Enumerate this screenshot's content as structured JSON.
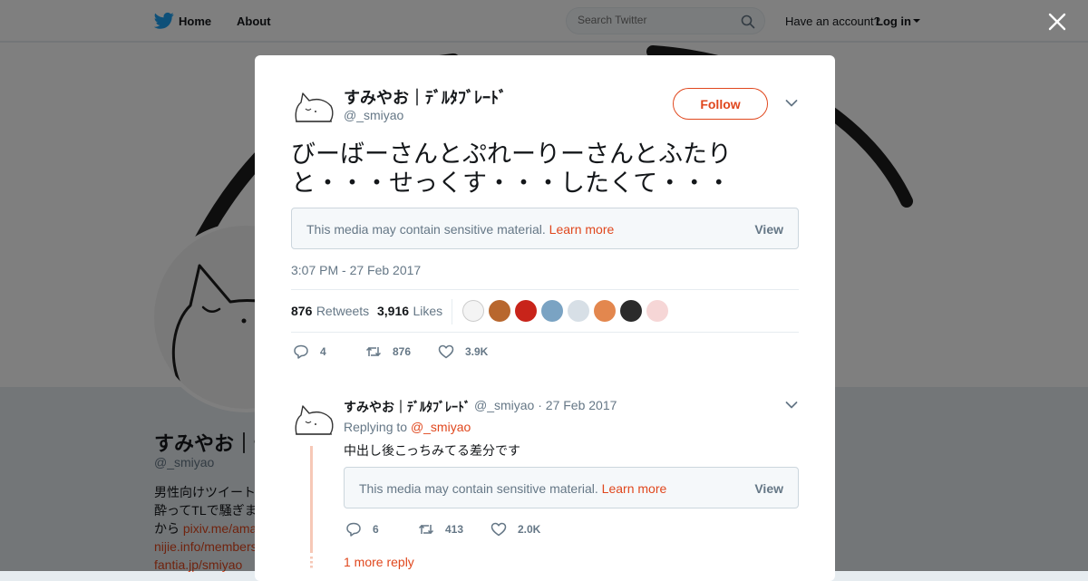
{
  "nav": {
    "home": "Home",
    "about": "About",
    "search_placeholder": "Search Twitter",
    "have_account": "Have an account?",
    "login": "Log in"
  },
  "profile": {
    "name": "すみやお｜ﾃﾞﾙﾀﾌﾞﾚｰﾄﾞ",
    "handle": "@_smiyao",
    "bio_lines": [
      "男性向けツイート",
      "酔ってTLで騒ぎま",
      "から "
    ],
    "bio_links": [
      "pixiv.me/ama",
      "nijie.info/members",
      "fantia.jp/smiyao"
    ]
  },
  "tweet": {
    "author_name": "すみやお｜ﾃﾞﾙﾀﾌﾞﾚｰﾄﾞ",
    "author_handle": "@_smiyao",
    "follow_label": "Follow",
    "text": "びーばーさんとぷれーりーさんとふたりと・・・せっくす・・・したくて・・・",
    "sensitive_notice": "This media may contain sensitive material.",
    "learn_more": "Learn more",
    "view_label": "View",
    "timestamp": "3:07 PM - 27 Feb 2017",
    "retweets_count": "876",
    "retweets_label": "Retweets",
    "likes_count": "3,916",
    "likes_label": "Likes",
    "actions": {
      "replies": "4",
      "retweets": "876",
      "likes": "3.9K"
    }
  },
  "reply": {
    "author_name": "すみやお｜ﾃﾞﾙﾀﾌﾞﾚｰﾄﾞ",
    "handle_date": "@_smiyao · 27 Feb 2017",
    "replying_to_label": "Replying to",
    "replying_to_handle": "@_smiyao",
    "text": "中出し後こっちみてる差分です",
    "sensitive_notice": "This media may contain sensitive material.",
    "learn_more": "Learn more",
    "view_label": "View",
    "actions": {
      "replies": "6",
      "retweets": "413",
      "likes": "2.0K"
    },
    "more_replies": "1 more reply"
  },
  "colors": {
    "accent": "#e0471d",
    "twitter_blue": "#1da1f2",
    "muted": "#657786",
    "thread_line": "#f6c8b7"
  },
  "icons": [
    "twitter-bird-icon",
    "search-icon",
    "caret-down-icon",
    "close-icon",
    "reply-icon",
    "retweet-icon",
    "heart-icon",
    "chevron-down-icon"
  ]
}
